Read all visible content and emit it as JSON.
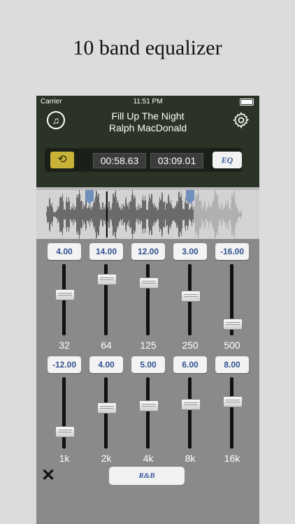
{
  "headline": "10 band equalizer",
  "status_bar": {
    "carrier": "Carrier",
    "time": "11:51 PM"
  },
  "track": {
    "title": "Fill Up The Night",
    "artist": "Ralph MacDonald"
  },
  "player": {
    "current_time": "00:58.63",
    "total_time": "03:09.01",
    "eq_label": "EQ",
    "progress": 0.31
  },
  "equalizer": {
    "row1": [
      {
        "value": "4.00",
        "freq": "32"
      },
      {
        "value": "14.00",
        "freq": "64"
      },
      {
        "value": "12.00",
        "freq": "125"
      },
      {
        "value": "3.00",
        "freq": "250"
      },
      {
        "value": "-16.00",
        "freq": "500"
      }
    ],
    "row2": [
      {
        "value": "-12.00",
        "freq": "1k"
      },
      {
        "value": "4.00",
        "freq": "2k"
      },
      {
        "value": "5.00",
        "freq": "4k"
      },
      {
        "value": "6.00",
        "freq": "8k"
      },
      {
        "value": "8.00",
        "freq": "16k"
      }
    ],
    "gain_range": [
      -24,
      24
    ],
    "preset_label": "R&B"
  },
  "icons": {
    "music": "music-note-icon",
    "settings": "gear-icon",
    "loop": "loop-icon",
    "close": "close-icon"
  },
  "colors": {
    "header_bg": "#2a3326",
    "loop_button": "#c8b238",
    "value_text": "#31508f"
  }
}
